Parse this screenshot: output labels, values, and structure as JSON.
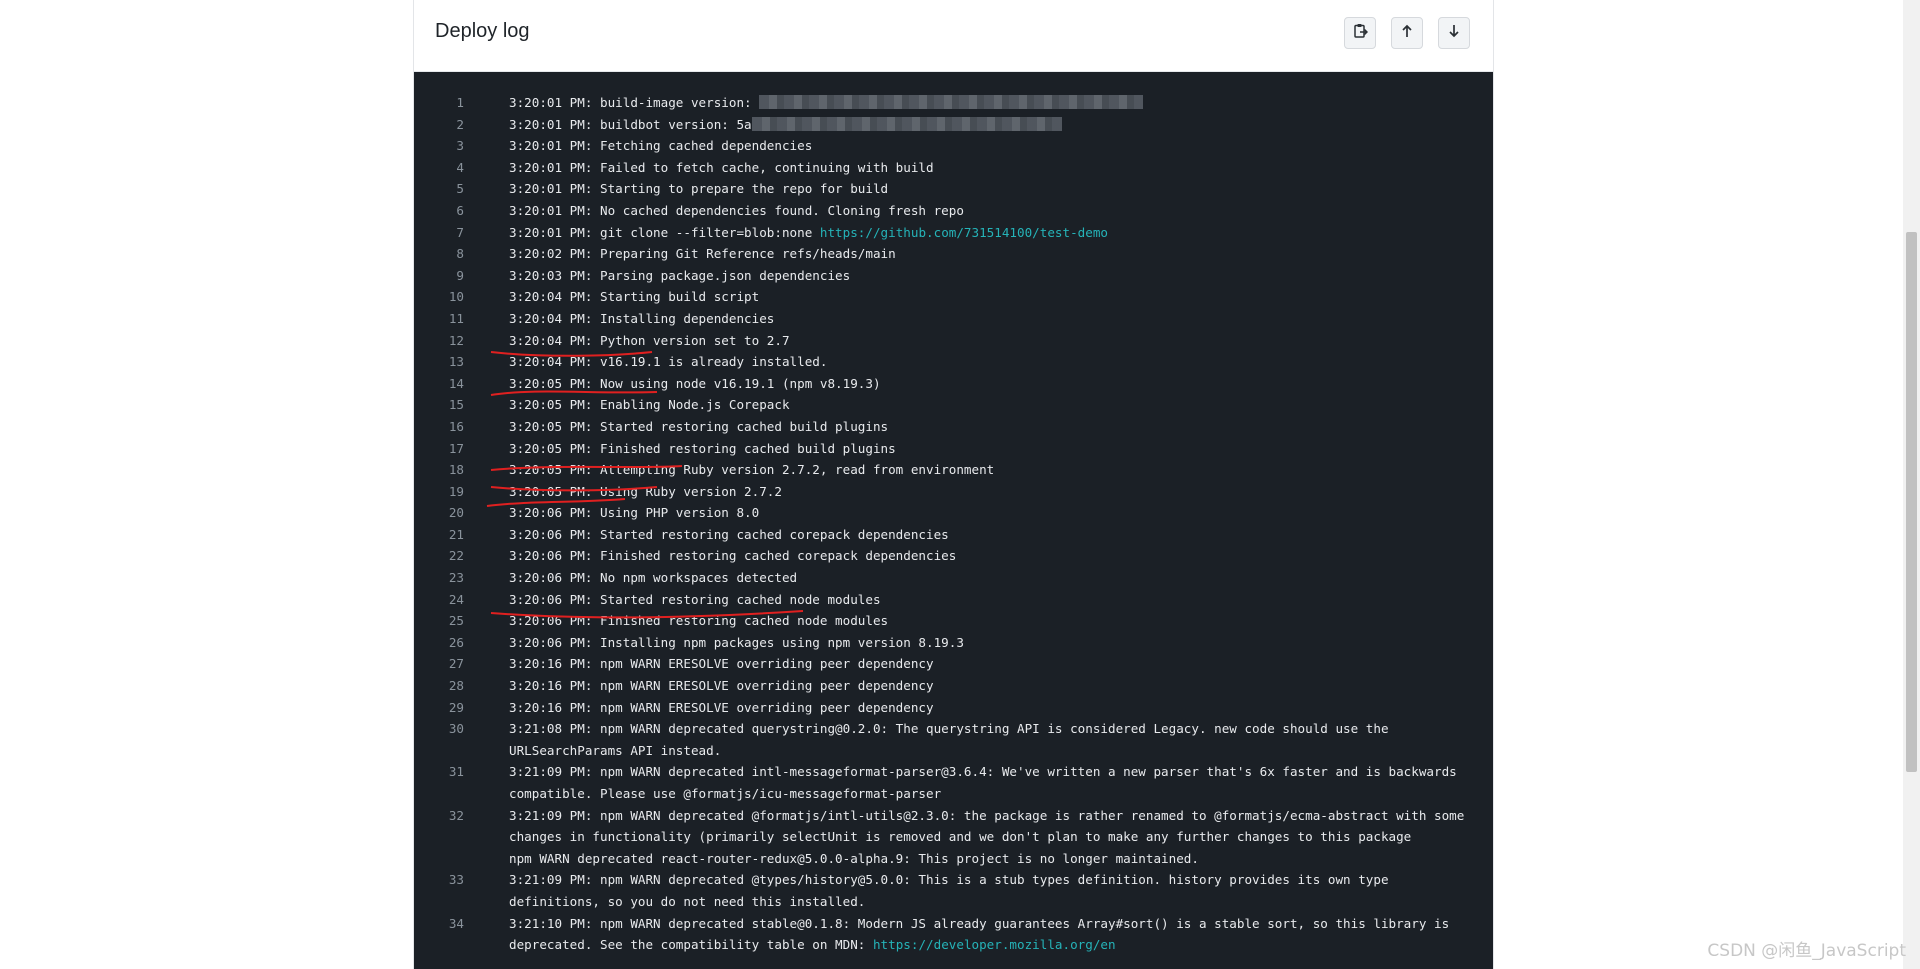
{
  "header": {
    "title": "Deploy log",
    "buttons": {
      "copy_icon": "clipboard-copy-icon",
      "up_icon": "arrow-up-icon",
      "down_icon": "arrow-down-icon"
    }
  },
  "log": {
    "lines": [
      {
        "n": "1",
        "pre": "3:20:01 PM: build-image version: ",
        "redacted": "r1"
      },
      {
        "n": "2",
        "pre": "3:20:01 PM: buildbot version: 5a",
        "redacted": "r2"
      },
      {
        "n": "3",
        "pre": "3:20:01 PM: Fetching cached dependencies"
      },
      {
        "n": "4",
        "pre": "3:20:01 PM: Failed to fetch cache, continuing with build"
      },
      {
        "n": "5",
        "pre": "3:20:01 PM: Starting to prepare the repo for build"
      },
      {
        "n": "6",
        "pre": "3:20:01 PM: No cached dependencies found. Cloning fresh repo"
      },
      {
        "n": "7",
        "pre": "3:20:01 PM: git clone --filter=blob:none ",
        "link": "https://github.com/731514100/test-demo"
      },
      {
        "n": "8",
        "pre": "3:20:02 PM: Preparing Git Reference refs/heads/main"
      },
      {
        "n": "9",
        "pre": "3:20:03 PM: Parsing package.json dependencies"
      },
      {
        "n": "10",
        "pre": "3:20:04 PM: Starting build script"
      },
      {
        "n": "11",
        "pre": "3:20:04 PM: Installing dependencies"
      },
      {
        "n": "12",
        "pre": "3:20:04 PM: Python version set to 2.7"
      },
      {
        "n": "13",
        "pre": "3:20:04 PM: v16.19.1 is already installed."
      },
      {
        "n": "14",
        "pre": "3:20:05 PM: Now using node v16.19.1 (npm v8.19.3)"
      },
      {
        "n": "15",
        "pre": "3:20:05 PM: Enabling Node.js Corepack"
      },
      {
        "n": "16",
        "pre": "3:20:05 PM: Started restoring cached build plugins"
      },
      {
        "n": "17",
        "pre": "3:20:05 PM: Finished restoring cached build plugins"
      },
      {
        "n": "18",
        "pre": "3:20:05 PM: Attempting Ruby version 2.7.2, read from environment"
      },
      {
        "n": "19",
        "pre": "3:20:05 PM: Using Ruby version 2.7.2"
      },
      {
        "n": "20",
        "pre": "3:20:06 PM: Using PHP version 8.0"
      },
      {
        "n": "21",
        "pre": "3:20:06 PM: Started restoring cached corepack dependencies"
      },
      {
        "n": "22",
        "pre": "3:20:06 PM: Finished restoring cached corepack dependencies"
      },
      {
        "n": "23",
        "pre": "3:20:06 PM: No npm workspaces detected"
      },
      {
        "n": "24",
        "pre": "3:20:06 PM: Started restoring cached node modules"
      },
      {
        "n": "25",
        "pre": "3:20:06 PM: Finished restoring cached node modules"
      },
      {
        "n": "26",
        "pre": "3:20:06 PM: Installing npm packages using npm version 8.19.3"
      },
      {
        "n": "27",
        "pre": "3:20:16 PM: npm WARN ERESOLVE overriding peer dependency"
      },
      {
        "n": "28",
        "pre": "3:20:16 PM: npm WARN ERESOLVE overriding peer dependency"
      },
      {
        "n": "29",
        "pre": "3:20:16 PM: npm WARN ERESOLVE overriding peer dependency"
      },
      {
        "n": "30",
        "pre": "3:21:08 PM: npm WARN deprecated querystring@0.2.0: The querystring API is considered Legacy. new code should use the URLSearchParams API instead."
      },
      {
        "n": "31",
        "pre": "3:21:09 PM: npm WARN deprecated intl-messageformat-parser@3.6.4: We've written a new parser that's 6x faster and is backwards compatible. Please use @formatjs/icu-messageformat-parser"
      },
      {
        "n": "32",
        "pre": "3:21:09 PM: npm WARN deprecated @formatjs/intl-utils@2.3.0: the package is rather renamed to @formatjs/ecma-abstract with some changes in functionality (primarily selectUnit is removed and we don't plan to make any further changes to this package\nnpm WARN deprecated react-router-redux@5.0.0-alpha.9: This project is no longer maintained."
      },
      {
        "n": "33",
        "pre": "3:21:09 PM: npm WARN deprecated @types/history@5.0.0: This is a stub types definition. history provides its own type definitions, so you do not need this installed."
      },
      {
        "n": "34",
        "pre": "3:21:10 PM: npm WARN deprecated stable@0.1.8: Modern JS already guarantees Array#sort() is a stable sort, so this library is deprecated. See the compatibility table on MDN: ",
        "link": "https://developer.mozilla.org/en"
      }
    ]
  },
  "watermark": "CSDN @闲鱼_JavaScript",
  "colors": {
    "log_bg": "#1b2026",
    "log_text": "#e8eaed",
    "link": "#25b3b8",
    "annotation": "#e02020"
  }
}
